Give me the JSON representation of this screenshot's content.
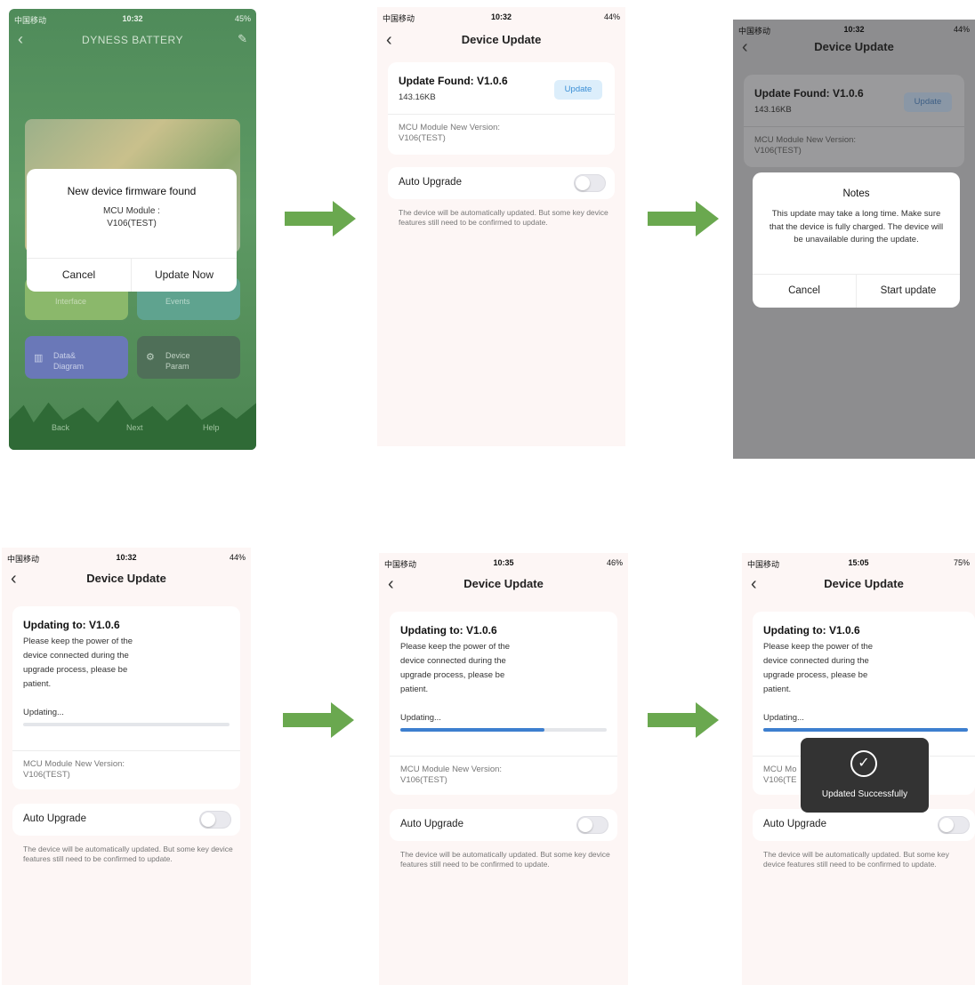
{
  "screen1": {
    "status": {
      "carrier": "中国移动",
      "time": "10:32",
      "battery": "45%"
    },
    "header_title": "DYNESS BATTERY",
    "tiles": [
      {
        "label": "Interface"
      },
      {
        "label": "Events"
      },
      {
        "label": "Data& Diagram"
      },
      {
        "label": "Device Param"
      }
    ],
    "bottom_nav": [
      "Back",
      "Next",
      "Help"
    ],
    "dialog": {
      "title": "New device firmware found",
      "line1": "MCU Module :",
      "line2": "V106(TEST)",
      "cancel": "Cancel",
      "confirm": "Update Now"
    }
  },
  "screen2": {
    "status": {
      "carrier": "中国移动",
      "time": "10:32",
      "battery": "44%"
    },
    "title": "Device Update",
    "update_found": "Update Found: V1.0.6",
    "size": "143.16KB",
    "update_button": "Update",
    "module_label": "MCU Module New Version:",
    "module_version": "V106(TEST)",
    "auto_upgrade": "Auto Upgrade",
    "auto_desc": "The device will be automatically updated. But some key device features still need to be confirmed to update."
  },
  "screen3": {
    "status": {
      "carrier": "中国移动",
      "time": "10:32",
      "battery": "44%"
    },
    "title": "Device Update",
    "update_found": "Update Found: V1.0.6",
    "size": "143.16KB",
    "update_button": "Update",
    "module_label": "MCU Module New Version:",
    "module_version": "V106(TEST)",
    "dialog": {
      "title": "Notes",
      "body": "This update may take a long time. Make sure that the device is fully charged. The device will be unavailable during the update.",
      "cancel": "Cancel",
      "confirm": "Start update"
    }
  },
  "screen4": {
    "status": {
      "carrier": "中国移动",
      "time": "10:32",
      "battery": "44%"
    },
    "title": "Device Update",
    "updating_to": "Updating to: V1.0.6",
    "note": "Please keep the power of the device connected during the upgrade process, please be patient.",
    "updating": "Updating...",
    "progress": 0.0,
    "module_label": "MCU Module New Version:",
    "module_version": "V106(TEST)",
    "auto_upgrade": "Auto Upgrade",
    "auto_desc": "The device will be automatically updated. But some key device features still need to be confirmed to update."
  },
  "screen5": {
    "status": {
      "carrier": "中国移动",
      "time": "10:35",
      "battery": "46%"
    },
    "title": "Device Update",
    "updating_to": "Updating to: V1.0.6",
    "note": "Please keep the power of the device connected during the upgrade process, please be patient.",
    "updating": "Updating...",
    "progress": 0.7,
    "module_label": "MCU Module New Version:",
    "module_version": "V106(TEST)",
    "auto_upgrade": "Auto Upgrade",
    "auto_desc": "The device will be automatically updated. But some key device features still need to be confirmed to update."
  },
  "screen6": {
    "status": {
      "carrier": "中国移动",
      "time": "15:05",
      "battery": "75%"
    },
    "title": "Device Update",
    "updating_to": "Updating to: V1.0.6",
    "note": "Please keep the power of the device connected during the upgrade process, please be patient.",
    "updating": "Updating...",
    "progress": 1.0,
    "module_label": "MCU Mo",
    "module_version": "V106(TE",
    "toast": "Updated Successfully",
    "auto_upgrade": "Auto Upgrade",
    "auto_desc": "The device will be automatically updated. But some key device features still need to be confirmed to update."
  },
  "colors": {
    "arrow": "#6aa84f",
    "accent": "#3d7fcf",
    "page_bg": "#fdf6f5",
    "toast_bg": "#333333"
  }
}
